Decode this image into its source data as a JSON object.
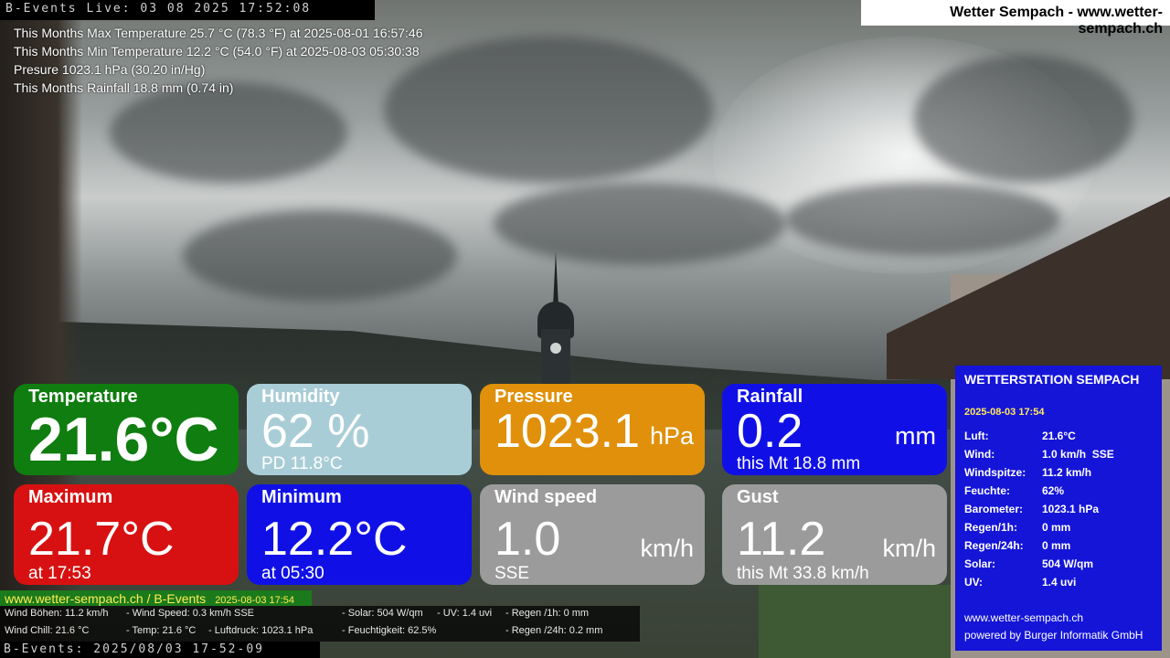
{
  "camera": {
    "top_overlay": "B-Events Live: 03 08 2025 17:52:08",
    "bottom_overlay": "B-Events: 2025/08/03 17-52-09"
  },
  "site_title": "Wetter Sempach - www.wetter-sempach.ch",
  "monthly_stats": {
    "max_temp": "This Months Max Temperature 25.7 °C (78.3 °F) at 2025-08-01 16:57:46",
    "min_temp": "This Months Min Temperature 12.2 °C (54.0 °F) at 2025-08-03 05:30:38",
    "pressure": "Presure 1023.1 hPa (30.20 in/Hg)",
    "rainfall": "This Months Rainfall 18.8 mm (0.74 in)"
  },
  "tiles": {
    "temperature": {
      "label": "Temperature",
      "value": "21.6°C",
      "color": "#0f7d0f"
    },
    "humidity": {
      "label": "Humidity",
      "value": "62 %",
      "sub": "PD 11.8°C",
      "color": "#a9cdd6"
    },
    "pressure": {
      "label": "Pressure",
      "value": "1023.1",
      "unit": "hPa",
      "color": "#e0900a"
    },
    "rainfall": {
      "label": "Rainfall",
      "value": "0.2",
      "unit": "mm",
      "sub": "this Mt 18.8 mm",
      "color": "#1010e6"
    },
    "maximum": {
      "label": "Maximum",
      "value": "21.7°C",
      "sub": "at 17:53",
      "color": "#d71111"
    },
    "minimum": {
      "label": "Minimum",
      "value": "12.2°C",
      "sub": "at 05:30",
      "color": "#1010e6"
    },
    "wind_speed": {
      "label": "Wind speed",
      "value": "1.0",
      "unit": "km/h",
      "sub": "SSE",
      "color": "#9b9b9b"
    },
    "gust": {
      "label": "Gust",
      "value": "11.2",
      "unit": "km/h",
      "sub": "this Mt 33.8 km/h",
      "color": "#9b9b9b"
    }
  },
  "station": {
    "title": "WETTERSTATION SEMPACH",
    "datetime": "2025-08-03 17:54",
    "rows": [
      {
        "key": "Luft:",
        "value": "21.6°C"
      },
      {
        "key": "Wind:",
        "value": "1.0 km/h  SSE"
      },
      {
        "key": "Windspitze:",
        "value": "11.2 km/h"
      },
      {
        "key": "Feuchte:",
        "value": "62%"
      },
      {
        "key": "Barometer:",
        "value": "1023.1 hPa"
      },
      {
        "key": "Regen/1h:",
        "value": "0 mm"
      },
      {
        "key": "Regen/24h:",
        "value": "0 mm"
      },
      {
        "key": "Solar:",
        "value": "504 W/qm"
      },
      {
        "key": "UV:",
        "value": "1.4 uvi"
      }
    ],
    "url": "www.wetter-sempach.ch",
    "powered": "powered by Burger Informatik GmbH",
    "color": "#1515d8"
  },
  "ticker": {
    "head": "www.wetter-sempach.ch / B-Events",
    "date": "2025-08-03 17:54",
    "line1": {
      "a": "Wind Böhen: 11.2 km/h",
      "b": "- Wind Speed: 0.3 km/h SSE",
      "c": "- Solar: 504 W/qm",
      "d": "- UV: 1.4 uvi",
      "e": "- Regen /1h:   0 mm"
    },
    "line2": {
      "a": "Wind Chill: 21.6 °C",
      "b": "- Temp: 21.6 °C",
      "c": "- Luftdruck: 1023.1 hPa",
      "d": "- Feuchtigkeit: 62.5%",
      "e": "- Regen /24h: 0.2 mm"
    }
  }
}
